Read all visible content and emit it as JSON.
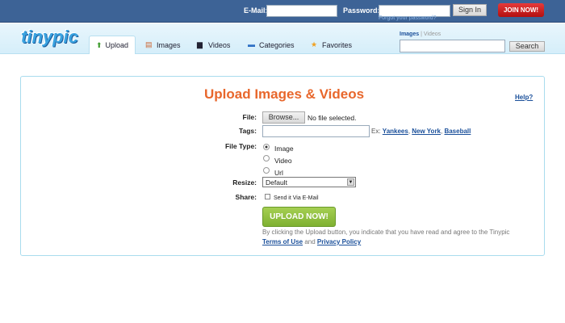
{
  "topbar": {
    "email_label": "E-Mail:",
    "password_label": "Password:",
    "forgot": "Forgot your password?",
    "sign_in": "Sign In",
    "join": "JOIN NOW!"
  },
  "nav": {
    "logo": "tinypic",
    "tabs": [
      {
        "label": "Upload"
      },
      {
        "label": "Images"
      },
      {
        "label": "Videos"
      },
      {
        "label": "Categories"
      },
      {
        "label": "Favorites"
      }
    ],
    "search": {
      "images": "Images",
      "sep": "|",
      "videos": "Videos",
      "button": "Search",
      "value": ""
    }
  },
  "form": {
    "title": "Upload Images & Videos",
    "help": "Help?",
    "file_label": "File:",
    "browse": "Browse...",
    "no_file": "No file selected.",
    "tags_label": "Tags:",
    "tags_value": "",
    "ex": "Ex:",
    "ex_links": [
      "Yankees",
      "New York",
      "Baseball"
    ],
    "type_label": "File Type:",
    "types": [
      "Image",
      "Video",
      "Url"
    ],
    "selected_type": "Image",
    "resize_label": "Resize:",
    "resize_value": "Default",
    "share_label": "Share:",
    "share_option": "Send it Via E-Mail",
    "upload": "UPLOAD NOW!",
    "agree": "By clicking the Upload button, you indicate that you have read and agree to the Tinypic",
    "terms": "Terms of Use",
    "and": "and",
    "privacy": "Privacy Policy"
  },
  "colors": {
    "topbar": "#3d6396",
    "title": "#e8672c",
    "upload_btn": "#8dbb3a",
    "join": "#c91c1c"
  }
}
